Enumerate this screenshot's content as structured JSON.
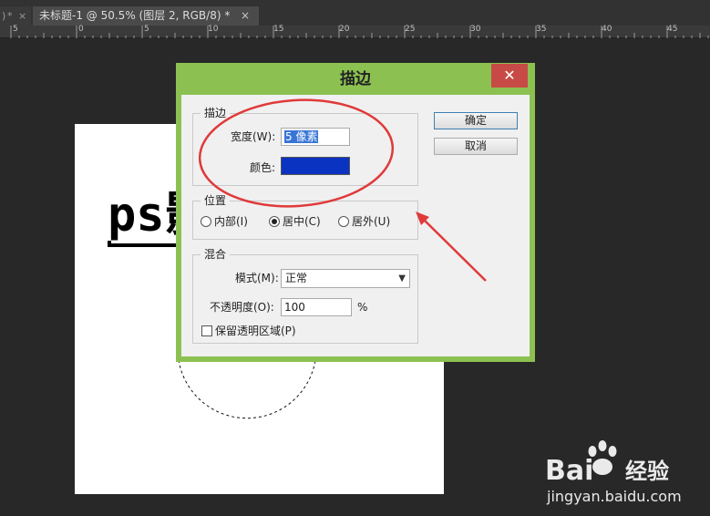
{
  "tabs": {
    "previous_tab": {
      "marker": ")",
      "modified": "*",
      "close": "×"
    },
    "active_tab": {
      "label": "未标题-1 @ 50.5% (图层 2, RGB/8) *",
      "close": "×"
    }
  },
  "ruler": {
    "labels": [
      "5",
      "0",
      "5",
      "10",
      "15",
      "20",
      "25",
      "30",
      "35",
      "40",
      "45"
    ]
  },
  "artwork": {
    "text": "ps影"
  },
  "stroke_dialog": {
    "title": "描边",
    "close": "✕",
    "stroke_group": {
      "legend": "描边",
      "width_label": "宽度(W):",
      "width_value": "5 像素",
      "color_label": "颜色:",
      "color": "#0b33c2"
    },
    "location_group": {
      "legend": "位置",
      "options": [
        "内部(I)",
        "居中(C)",
        "居外(U)"
      ],
      "selected_index": 1
    },
    "blending_group": {
      "legend": "混合",
      "mode_label": "模式(M):",
      "mode_value": "正常",
      "opacity_label": "不透明度(O):",
      "opacity_value": "100",
      "opacity_unit": "%",
      "preserve_transparency_label": "保留透明区域(P)",
      "preserve_transparency_checked": false
    },
    "ok_button": "确定",
    "cancel_button": "取消"
  },
  "annotation": {
    "color": "#e03a3a"
  },
  "watermark": {
    "brand_left": "Bai",
    "brand_right": "经验",
    "url": "jingyan.baidu.com"
  }
}
